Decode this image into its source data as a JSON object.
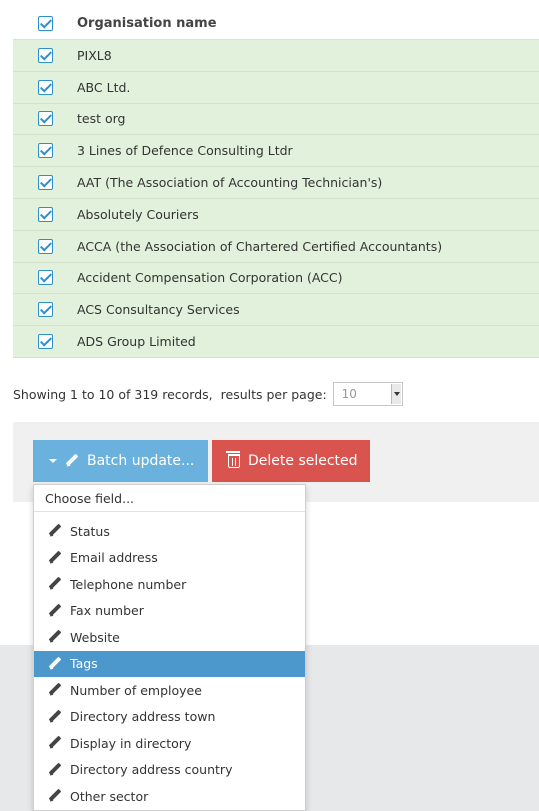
{
  "table": {
    "header": "Organisation name",
    "rows": [
      "PIXL8",
      "ABC Ltd.",
      "test org",
      "3 Lines of Defence Consulting Ltdr",
      "AAT (The Association of Accounting Technician's)",
      "Absolutely Couriers",
      "ACCA (the Association of Chartered Certified Accountants)",
      "Accident Compensation Corporation (ACC)",
      "ACS Consultancy Services",
      "ADS Group Limited"
    ]
  },
  "pager": {
    "showing": "Showing 1 to 10 of 319 records,",
    "rpp_label": "results per page:",
    "rpp_value": "10"
  },
  "actions": {
    "batch_label": "Batch update...",
    "delete_label": "Delete selected"
  },
  "dropdown": {
    "header": "Choose field...",
    "items": [
      "Status",
      "Email address",
      "Telephone number",
      "Fax number",
      "Website",
      "Tags",
      "Number of employee",
      "Directory address town",
      "Display in directory",
      "Directory address country",
      "Other sector"
    ],
    "active": "Tags"
  },
  "colors": {
    "row_selected": "#e2f1dc",
    "batch_button": "#6ab1dd",
    "delete_button": "#d9534f",
    "active_item": "#4c98cc"
  }
}
